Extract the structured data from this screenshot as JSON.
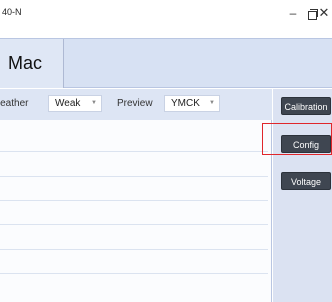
{
  "window": {
    "title": "40-N",
    "minimize_glyph": "–",
    "close_glyph": "✕",
    "icons": [
      "minimize-icon",
      "restore-icon",
      "close-icon"
    ]
  },
  "header": {
    "app_tab_label": "Mac"
  },
  "options": {
    "feather_label": "Feather",
    "feather_value": "Weak",
    "preview_label": "Preview",
    "preview_value": "YMCK",
    "dropdown_arrow": "▼"
  },
  "side_panel": {
    "calibration_label": "Calibration",
    "config_label": "Config",
    "voltage_label": "Voltage"
  },
  "colors": {
    "accent_panel": "#d7e1f3",
    "button_dark": "#3f4651",
    "highlight_red": "#e0262b"
  }
}
